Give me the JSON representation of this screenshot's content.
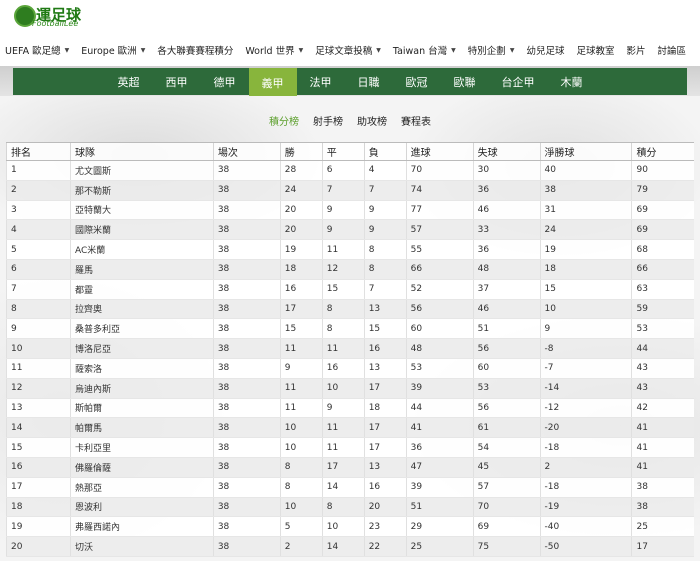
{
  "logo": {
    "main": "運足球",
    "sub": "FootballLee"
  },
  "topnav": [
    {
      "label": "UEFA 歐足總",
      "dropdown": true
    },
    {
      "label": "Europe 歐洲",
      "dropdown": true
    },
    {
      "label": "各大聯賽賽程積分",
      "dropdown": false
    },
    {
      "label": "World 世界",
      "dropdown": true
    },
    {
      "label": "足球文章投稿",
      "dropdown": true
    },
    {
      "label": "Taiwan 台灣",
      "dropdown": true
    },
    {
      "label": "特別企劃",
      "dropdown": true
    },
    {
      "label": "幼兒足球",
      "dropdown": false
    },
    {
      "label": "足球教室",
      "dropdown": false
    },
    {
      "label": "影片",
      "dropdown": false
    },
    {
      "label": "討論區",
      "dropdown": false
    }
  ],
  "leagues": [
    {
      "label": "英超",
      "active": false
    },
    {
      "label": "西甲",
      "active": false
    },
    {
      "label": "德甲",
      "active": false
    },
    {
      "label": "義甲",
      "active": true
    },
    {
      "label": "法甲",
      "active": false
    },
    {
      "label": "日職",
      "active": false
    },
    {
      "label": "歐冠",
      "active": false
    },
    {
      "label": "歐聯",
      "active": false
    },
    {
      "label": "台企甲",
      "active": false
    },
    {
      "label": "木蘭",
      "active": false
    }
  ],
  "subtabs": [
    {
      "label": "積分榜",
      "active": true
    },
    {
      "label": "射手榜",
      "active": false
    },
    {
      "label": "助攻榜",
      "active": false
    },
    {
      "label": "賽程表",
      "active": false
    }
  ],
  "table": {
    "headers": [
      "排名",
      "球隊",
      "場次",
      "勝",
      "平",
      "負",
      "進球",
      "失球",
      "淨勝球",
      "積分"
    ],
    "rows": [
      [
        "1",
        "尤文圖斯",
        "38",
        "28",
        "6",
        "4",
        "70",
        "30",
        "40",
        "90"
      ],
      [
        "2",
        "那不勒斯",
        "38",
        "24",
        "7",
        "7",
        "74",
        "36",
        "38",
        "79"
      ],
      [
        "3",
        "亞特蘭大",
        "38",
        "20",
        "9",
        "9",
        "77",
        "46",
        "31",
        "69"
      ],
      [
        "4",
        "國際米蘭",
        "38",
        "20",
        "9",
        "9",
        "57",
        "33",
        "24",
        "69"
      ],
      [
        "5",
        "AC米蘭",
        "38",
        "19",
        "11",
        "8",
        "55",
        "36",
        "19",
        "68"
      ],
      [
        "6",
        "羅馬",
        "38",
        "18",
        "12",
        "8",
        "66",
        "48",
        "18",
        "66"
      ],
      [
        "7",
        "都靈",
        "38",
        "16",
        "15",
        "7",
        "52",
        "37",
        "15",
        "63"
      ],
      [
        "8",
        "拉齊奧",
        "38",
        "17",
        "8",
        "13",
        "56",
        "46",
        "10",
        "59"
      ],
      [
        "9",
        "桑普多利亞",
        "38",
        "15",
        "8",
        "15",
        "60",
        "51",
        "9",
        "53"
      ],
      [
        "10",
        "博洛尼亞",
        "38",
        "11",
        "11",
        "16",
        "48",
        "56",
        "-8",
        "44"
      ],
      [
        "11",
        "薩索洛",
        "38",
        "9",
        "16",
        "13",
        "53",
        "60",
        "-7",
        "43"
      ],
      [
        "12",
        "烏迪內斯",
        "38",
        "11",
        "10",
        "17",
        "39",
        "53",
        "-14",
        "43"
      ],
      [
        "13",
        "斯帕爾",
        "38",
        "11",
        "9",
        "18",
        "44",
        "56",
        "-12",
        "42"
      ],
      [
        "14",
        "帕爾馬",
        "38",
        "10",
        "11",
        "17",
        "41",
        "61",
        "-20",
        "41"
      ],
      [
        "15",
        "卡利亞里",
        "38",
        "10",
        "11",
        "17",
        "36",
        "54",
        "-18",
        "41"
      ],
      [
        "16",
        "佛羅倫薩",
        "38",
        "8",
        "17",
        "13",
        "47",
        "45",
        "2",
        "41"
      ],
      [
        "17",
        "熱那亞",
        "38",
        "8",
        "14",
        "16",
        "39",
        "57",
        "-18",
        "38"
      ],
      [
        "18",
        "恩波利",
        "38",
        "10",
        "8",
        "20",
        "51",
        "70",
        "-19",
        "38"
      ],
      [
        "19",
        "弗羅西諾內",
        "38",
        "5",
        "10",
        "23",
        "29",
        "69",
        "-40",
        "25"
      ],
      [
        "20",
        "切沃",
        "38",
        "2",
        "14",
        "22",
        "25",
        "75",
        "-50",
        "17"
      ]
    ]
  },
  "colors": {
    "league_bar": "#2d6a3a",
    "active_tab": "#88b53c",
    "active_subtab": "#5a9e2a"
  }
}
